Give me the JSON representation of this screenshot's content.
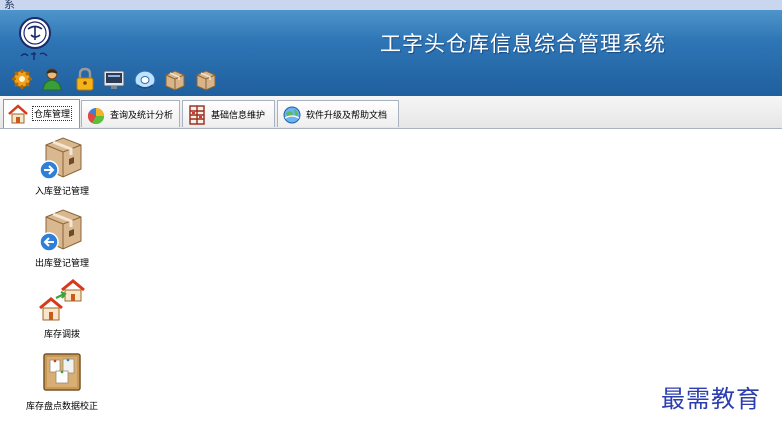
{
  "window": {
    "title_fragment": "系"
  },
  "header": {
    "app_title": "工字头仓库信息综合管理系统"
  },
  "quick_toolbar": {
    "icons": [
      "gear-icon",
      "user-icon",
      "lock-icon",
      "monitor-icon",
      "disc-icon",
      "box-icon",
      "box-icon"
    ]
  },
  "tabs": [
    {
      "label": "仓库管理",
      "icon": "house-icon",
      "active": true
    },
    {
      "label": "查询及统计分析",
      "icon": "pie-chart-icon",
      "active": false
    },
    {
      "label": "基础信息维护",
      "icon": "shelf-icon",
      "active": false
    },
    {
      "label": "软件升级及帮助文档",
      "icon": "globe-icon",
      "active": false
    }
  ],
  "modules": [
    {
      "label": "入库登记管理",
      "icon": "box-inbound-icon"
    },
    {
      "label": "出库登记管理",
      "icon": "box-outbound-icon"
    },
    {
      "label": "库存调拨",
      "icon": "warehouse-transfer-icon"
    },
    {
      "label": "库存盘点数据校正",
      "icon": "inventory-board-icon"
    }
  ],
  "watermark": "最需教育",
  "colors": {
    "banner": "#2f76b6",
    "banner_light": "#4f95cb",
    "watermark": "#2c3db0",
    "tab_border": "#a8b2c0"
  }
}
